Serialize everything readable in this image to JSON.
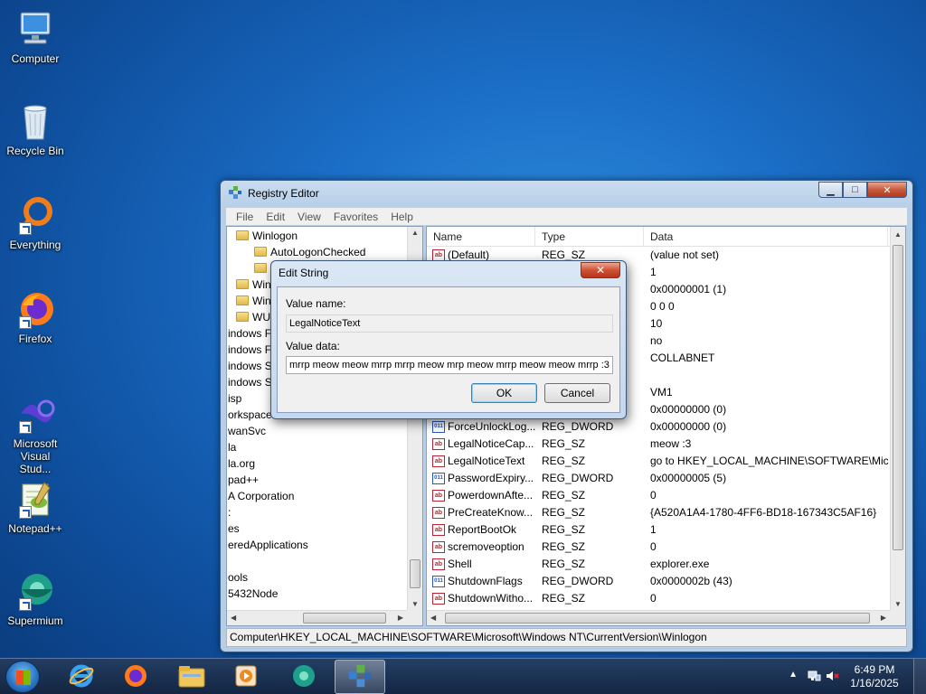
{
  "desktop": {
    "icons": [
      {
        "label": "Computer"
      },
      {
        "label": "Recycle Bin"
      },
      {
        "label": "Everything"
      },
      {
        "label": "Firefox"
      },
      {
        "label": "Microsoft Visual Stud..."
      },
      {
        "label": "Notepad++"
      },
      {
        "label": "Supermium"
      }
    ]
  },
  "regedit": {
    "title": "Registry Editor",
    "menu": [
      "File",
      "Edit",
      "View",
      "Favorites",
      "Help"
    ],
    "tree": [
      "Winlogon",
      "AutoLogonChecked",
      "",
      "Win",
      "Win",
      "WU",
      "indows F",
      "indows F",
      "indows S",
      "indows S",
      "isp",
      "orkspace",
      "wanSvc",
      "la",
      "la.org",
      "pad++",
      "A Corporation",
      ":",
      "es",
      "eredApplications",
      "",
      "ools",
      "5432Node"
    ],
    "columns": {
      "name": "Name",
      "type": "Type",
      "data": "Data"
    },
    "rows": [
      {
        "name": "(Default)",
        "type": "REG_SZ",
        "data": "(value not set)",
        "icon": "sz"
      },
      {
        "name": "",
        "type": "",
        "data": "1",
        "icon": "sz"
      },
      {
        "name": "",
        "type": "",
        "data": "0x00000001 (1)",
        "icon": "dw"
      },
      {
        "name": "",
        "type": "",
        "data": "0 0 0",
        "icon": "sz"
      },
      {
        "name": "",
        "type": "",
        "data": "10",
        "icon": "sz"
      },
      {
        "name": "",
        "type": "",
        "data": "no",
        "icon": "sz"
      },
      {
        "name": "",
        "type": "",
        "data": "COLLABNET",
        "icon": "sz"
      },
      {
        "name": "",
        "type": "",
        "data": "",
        "icon": "sz"
      },
      {
        "name": "",
        "type": "",
        "data": "VM1",
        "icon": "sz"
      },
      {
        "name": "",
        "type": "",
        "data": "0x00000000 (0)",
        "icon": "dw"
      },
      {
        "name": "ForceUnlockLog...",
        "type": "REG_DWORD",
        "data": "0x00000000 (0)",
        "icon": "dw"
      },
      {
        "name": "LegalNoticeCap...",
        "type": "REG_SZ",
        "data": "meow :3",
        "icon": "sz"
      },
      {
        "name": "LegalNoticeText",
        "type": "REG_SZ",
        "data": "go to HKEY_LOCAL_MACHINE\\SOFTWARE\\Micros",
        "icon": "sz"
      },
      {
        "name": "PasswordExpiry...",
        "type": "REG_DWORD",
        "data": "0x00000005 (5)",
        "icon": "dw"
      },
      {
        "name": "PowerdownAfte...",
        "type": "REG_SZ",
        "data": "0",
        "icon": "sz"
      },
      {
        "name": "PreCreateKnow...",
        "type": "REG_SZ",
        "data": "{A520A1A4-1780-4FF6-BD18-167343C5AF16}",
        "icon": "sz"
      },
      {
        "name": "ReportBootOk",
        "type": "REG_SZ",
        "data": "1",
        "icon": "sz"
      },
      {
        "name": "scremoveoption",
        "type": "REG_SZ",
        "data": "0",
        "icon": "sz"
      },
      {
        "name": "Shell",
        "type": "REG_SZ",
        "data": "explorer.exe",
        "icon": "sz"
      },
      {
        "name": "ShutdownFlags",
        "type": "REG_DWORD",
        "data": "0x0000002b (43)",
        "icon": "dw"
      },
      {
        "name": "ShutdownWitho...",
        "type": "REG_SZ",
        "data": "0",
        "icon": "sz"
      }
    ],
    "status": "Computer\\HKEY_LOCAL_MACHINE\\SOFTWARE\\Microsoft\\Windows NT\\CurrentVersion\\Winlogon"
  },
  "dialog": {
    "title": "Edit String",
    "value_name_label": "Value name:",
    "value_name": "LegalNoticeText",
    "value_data_label": "Value data:",
    "value_data": "mrrp meow meow mrrp mrrp meow mrp meow mrrp meow meow mrrp :3",
    "ok": "OK",
    "cancel": "Cancel",
    "close_glyph": "✕"
  },
  "taskbar": {
    "time": "6:49 PM",
    "date": "1/16/2025"
  },
  "colors": {
    "accent": "#1a6cc4",
    "close_red": "#c85a3c"
  }
}
